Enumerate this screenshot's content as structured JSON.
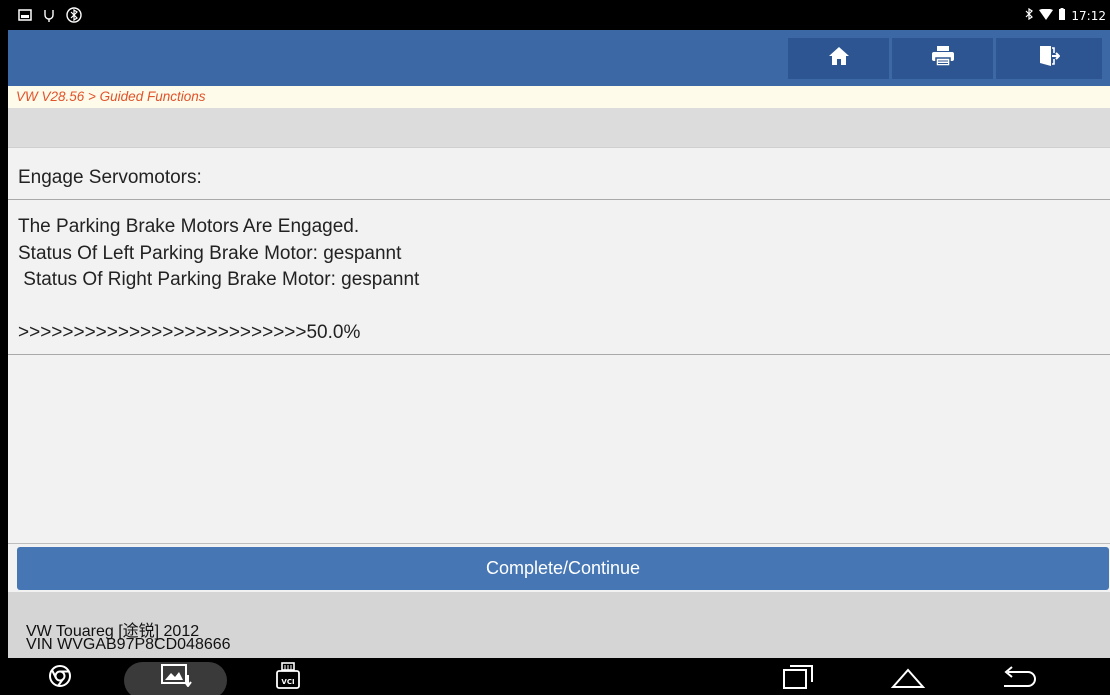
{
  "status_bar": {
    "time": "17:12",
    "left_icons": [
      "screenshot-icon",
      "usb-icon",
      "bluetooth-tether-icon"
    ],
    "right_icons": [
      "bluetooth-icon",
      "wifi-icon",
      "battery-icon"
    ]
  },
  "header": {
    "buttons": [
      {
        "name": "home",
        "icon": "home-icon"
      },
      {
        "name": "print",
        "icon": "printer-icon"
      },
      {
        "name": "exit",
        "icon": "exit-icon"
      }
    ],
    "accent_color": "#3c68a6"
  },
  "breadcrumb": "VW V28.56 > Guided Functions",
  "main": {
    "title": "Engage Servomotors:",
    "message_lines": [
      "The Parking Brake Motors Are Engaged.",
      "Status Of Left Parking Brake Motor: gespannt",
      " Status Of Right Parking Brake Motor: gespannt"
    ],
    "progress_text": ">>>>>>>>>>>>>>>>>>>>>>>>>>50.0%",
    "progress_value": 50.0
  },
  "actions": {
    "complete_label": "Complete/Continue"
  },
  "vehicle": {
    "model_line": "VW Touareg [途锐] 2012",
    "vin_line": "VIN WVGAB97P8CD048666"
  },
  "nav_bar": {
    "icons": [
      "chrome-icon",
      "gallery-icon",
      "vci-icon",
      "recents-icon",
      "home-nav-icon",
      "back-icon"
    ],
    "vci_label": "VCI"
  }
}
